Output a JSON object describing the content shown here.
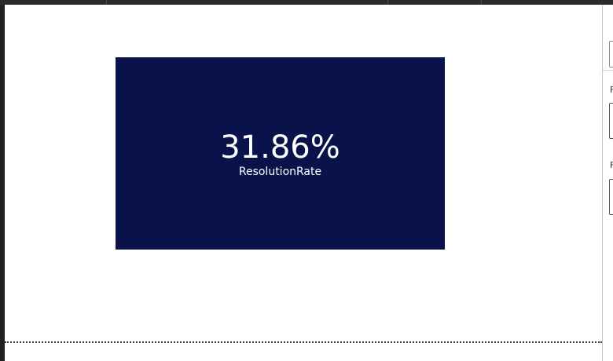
{
  "card": {
    "value": "31.86%",
    "label": "ResolutionRate",
    "background_color": "#0a124c",
    "text_color": "#ffffff"
  },
  "right_panel": {
    "section_labels": [
      "F",
      "F"
    ]
  }
}
